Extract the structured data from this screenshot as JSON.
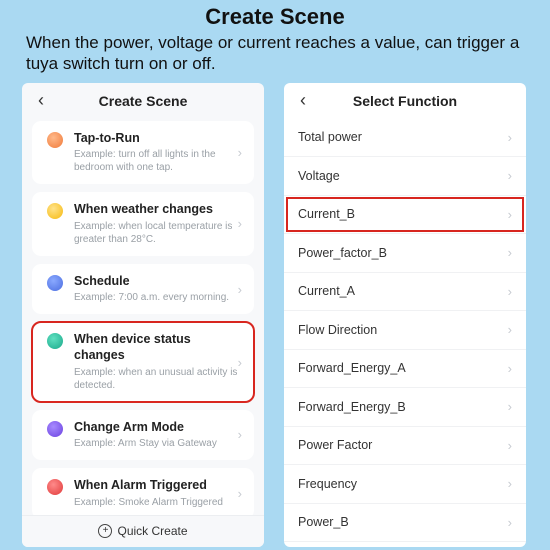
{
  "page": {
    "title": "Create Scene",
    "description": "When the power, voltage or current reaches a value, can trigger a tuya switch turn on or off."
  },
  "left": {
    "header": "Create Scene",
    "footer": "Quick Create",
    "cards": [
      {
        "title": "Tap-to-Run",
        "sub": "Example: turn off all lights in the bedroom with one tap."
      },
      {
        "title": "When weather changes",
        "sub": "Example: when local temperature is greater than 28°C."
      },
      {
        "title": "Schedule",
        "sub": "Example: 7:00 a.m. every morning."
      },
      {
        "title": "When device status changes",
        "sub": "Example: when an unusual activity is detected."
      },
      {
        "title": "Change Arm Mode",
        "sub": "Example: Arm Stay via Gateway"
      },
      {
        "title": "When Alarm Triggered",
        "sub": "Example: Smoke Alarm Triggered"
      }
    ]
  },
  "right": {
    "header": "Select Function",
    "items": [
      "Total power",
      "Voltage",
      "Current_B",
      "Power_factor_B",
      "Current_A",
      "Flow Direction",
      "Forward_Energy_A",
      "Forward_Energy_B",
      "Power Factor",
      "Frequency",
      "Power_B"
    ]
  }
}
